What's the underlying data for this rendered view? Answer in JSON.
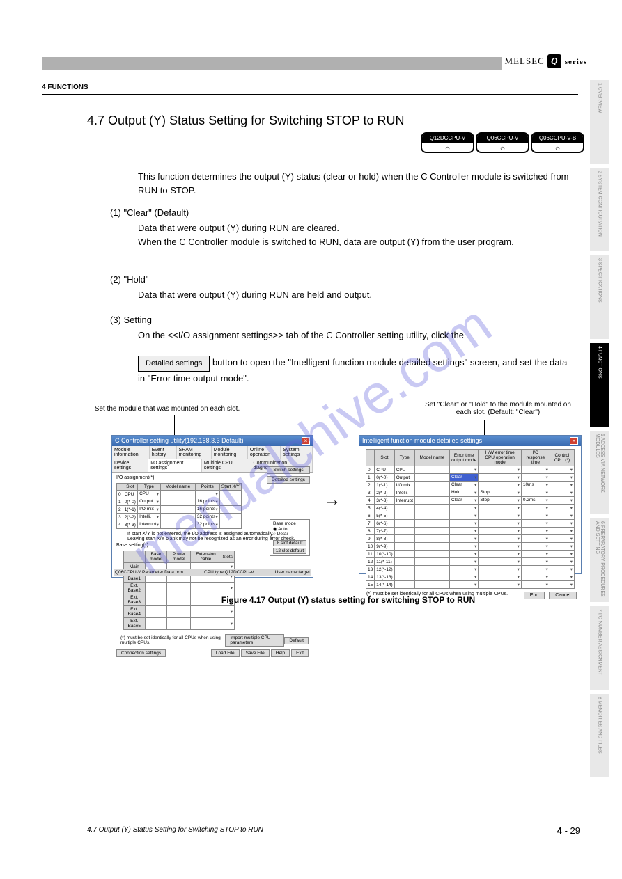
{
  "header": {
    "brand_prefix": "MELSEC",
    "brand_q": "Q",
    "brand_suffix": "series",
    "section_line": "4   FUNCTIONS",
    "section_title": "4.7 Output (Y) Status Setting for Switching STOP to RUN"
  },
  "applicability": [
    {
      "model": "Q12DCCPU-V",
      "mark": "○"
    },
    {
      "model": "Q06CCPU-V",
      "mark": "○"
    },
    {
      "model": "Q06CCPU-V-B",
      "mark": "○"
    }
  ],
  "paragraphs": {
    "p1": "This function determines the output (Y) status (clear or hold) when the C Controller module is switched from RUN to STOP.",
    "sub1_label": "(1) \"Clear\" (Default)",
    "sub1_text": "Data that were output (Y) during RUN are cleared.\nWhen the C Controller module is switched to RUN, data are output (Y) from the user program.",
    "sub2_label": "(2) \"Hold\"",
    "sub2_text": "Data that were output (Y) during RUN are held and output.",
    "sub3_label": "(3) Setting",
    "sub3_text_a": "On the <<I/O assignment settings>> tab of the C Controller setting utility, click the ",
    "sub3_btn": "Detailed settings",
    "sub3_text_b": " button to open the \"Intelligent function module detailed settings\" screen, and set the data in \"Error time output mode\"."
  },
  "figure": {
    "callout_left": "Set the module that was mounted on each slot.",
    "callout_right": "Set \"Clear\" or \"Hold\" to the module mounted on each slot. (Default: \"Clear\")",
    "caption": "Figure 4.17 Output (Y) status setting for switching STOP to RUN",
    "left_dialog": {
      "title": "C Controller setting utility(192.168.3.3 Default)",
      "tabs": [
        "Module information",
        "Event history",
        "SRAM monitoring",
        "Module monitoring",
        "Online operation",
        "System settings"
      ],
      "tabs2": [
        "Device settings",
        "I/O assignment settings",
        "Multiple CPU settings",
        "Communication diagnostics"
      ],
      "section_label": "I/O assignment(*)",
      "io_headers": [
        "",
        "Slot",
        "Type",
        "Model name",
        "Points",
        "Start X/Y"
      ],
      "io_rows": [
        [
          "0",
          "CPU",
          "CPU",
          "",
          "",
          ""
        ],
        [
          "1",
          "0(*-0)",
          "Output",
          "",
          "16 points",
          ""
        ],
        [
          "2",
          "1(*-1)",
          "I/O mix",
          "",
          "16 points",
          ""
        ],
        [
          "3",
          "2(*-2)",
          "Intelli.",
          "",
          "32 points",
          ""
        ],
        [
          "4",
          "3(*-3)",
          "Interrupt",
          "",
          "32 points",
          ""
        ]
      ],
      "io_note": "If start X/Y is not entered, the I/O address is assigned automatically.\nLeaving start X/Y blank may not be recognized as an error during error check.",
      "base_label": "Base setting(*)",
      "base_headers": [
        "",
        "Base model",
        "Power model",
        "Extension cable",
        "Slots"
      ],
      "base_rows": [
        "Main",
        "Ext. Base1",
        "Ext. Base2",
        "Ext. Base3",
        "Ext. Base4",
        "Ext. Base5"
      ],
      "base_mode_title": "Base mode",
      "base_mode_opts": [
        "Auto",
        "Detail"
      ],
      "base_btns": [
        "8 slot default",
        "12 slot default"
      ],
      "switch_btn": "Switch settings",
      "detailed_btn": "Detailed settings",
      "footer_note": "(*) must be set identically for all CPUs when using multiple CPUs.",
      "import_btn": "Import multiple CPU parameters",
      "default_btn": "Default",
      "bottom_btns": [
        "Connection settings",
        "Load File",
        "Save File",
        "Help",
        "Exit"
      ],
      "status": [
        "Q06CCPU-V Parameter Data.prm",
        "CPU type:Q12DCCPU-V",
        "User name:target"
      ]
    },
    "right_dialog": {
      "title": "Intelligent function module detailed settings",
      "headers": [
        "",
        "Slot",
        "Type",
        "Model name",
        "Error time output mode",
        "H/W error time CPU operation mode",
        "I/O response time",
        "Control CPU (*)"
      ],
      "rows": [
        {
          "n": "0",
          "slot": "CPU",
          "type": "CPU"
        },
        {
          "n": "1",
          "slot": "0(*-0)",
          "type": "Output",
          "err": "Clear",
          "errblue": true
        },
        {
          "n": "2",
          "slot": "1(*-1)",
          "type": "I/O mix",
          "err": "Clear",
          "io": "10ms"
        },
        {
          "n": "3",
          "slot": "2(*-2)",
          "type": "Intelli.",
          "err": "Hold",
          "hw": "Stop"
        },
        {
          "n": "4",
          "slot": "3(*-3)",
          "type": "Interrupt",
          "err": "Clear",
          "hw": "Stop",
          "io": "0.2ms"
        },
        {
          "n": "5",
          "slot": "4(*-4)"
        },
        {
          "n": "6",
          "slot": "5(*-5)"
        },
        {
          "n": "7",
          "slot": "6(*-6)"
        },
        {
          "n": "8",
          "slot": "7(*-7)"
        },
        {
          "n": "9",
          "slot": "8(*-8)"
        },
        {
          "n": "10",
          "slot": "9(*-9)"
        },
        {
          "n": "11",
          "slot": "10(*-10)"
        },
        {
          "n": "12",
          "slot": "11(*-11)"
        },
        {
          "n": "13",
          "slot": "12(*-12)"
        },
        {
          "n": "14",
          "slot": "13(*-13)"
        },
        {
          "n": "15",
          "slot": "14(*-14)"
        }
      ],
      "footer_note": "(*) must be set identically for all CPUs when using multiple CPUs.",
      "btns": [
        "End",
        "Cancel"
      ]
    }
  },
  "side_tabs": [
    {
      "n": "1",
      "t": "OVERVIEW"
    },
    {
      "n": "2",
      "t": "SYSTEM CONFIGURATION"
    },
    {
      "n": "3",
      "t": "SPECIFICATIONS"
    },
    {
      "n": "4",
      "t": "FUNCTIONS",
      "active": true
    },
    {
      "n": "5",
      "t": "ACCESS VIA NETWORK MODULES"
    },
    {
      "n": "6",
      "t": "PREPARATORY PROCEDURES AND SETTING"
    },
    {
      "n": "7",
      "t": "I/O NUMBER ASSIGNMENT"
    },
    {
      "n": "8",
      "t": "MEMORIES AND FILES"
    }
  ],
  "footer": {
    "line": "4.7 Output (Y) Status Setting for Switching STOP to RUN",
    "page_chapter": "4",
    "page_num": "- 29"
  },
  "watermark": "manualchive.com"
}
